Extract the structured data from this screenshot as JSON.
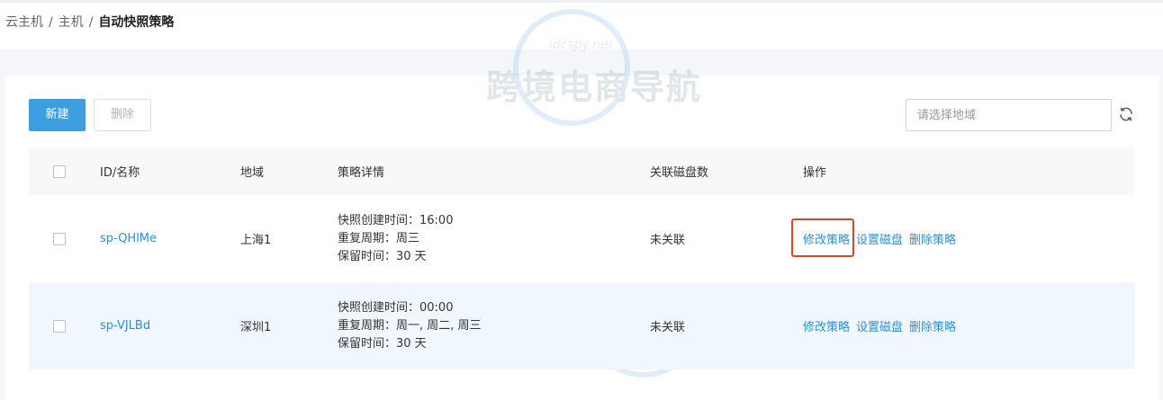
{
  "breadcrumb": {
    "items": [
      "云主机",
      "主机"
    ],
    "separator": "/",
    "current": "自动快照策略"
  },
  "toolbar": {
    "new_label": "新建",
    "delete_label": "删除",
    "region_placeholder": "请选择地域",
    "refresh_icon": "refresh-icon"
  },
  "table": {
    "headers": {
      "id_name": "ID/名称",
      "region": "地域",
      "detail": "策略详情",
      "disks": "关联磁盘数",
      "ops": "操作"
    },
    "rows": [
      {
        "id": "sp-QHlMe",
        "region": "上海1",
        "detail_time": "快照创建时间：16:00",
        "detail_cycle": "重复周期：周三",
        "detail_retention": "保留时间：30 天",
        "disks": "未关联",
        "op_edit": "修改策略",
        "op_set_disk": "设置磁盘",
        "op_delete": "删除策略"
      },
      {
        "id": "sp-VJLBd",
        "region": "深圳1",
        "detail_time": "快照创建时间：00:00",
        "detail_cycle": "重复周期：周一, 周二, 周三",
        "detail_retention": "保留时间：30 天",
        "disks": "未关联",
        "op_edit": "修改策略",
        "op_set_disk": "设置磁盘",
        "op_delete": "删除策略"
      }
    ]
  },
  "watermark": {
    "text": "跨境电商导航",
    "url": "idcspy.net"
  },
  "colors": {
    "primary": "#3d9fe0",
    "link": "#2f8fd6",
    "highlight_border": "#d9452b",
    "row_alt": "#f0f7fe"
  }
}
